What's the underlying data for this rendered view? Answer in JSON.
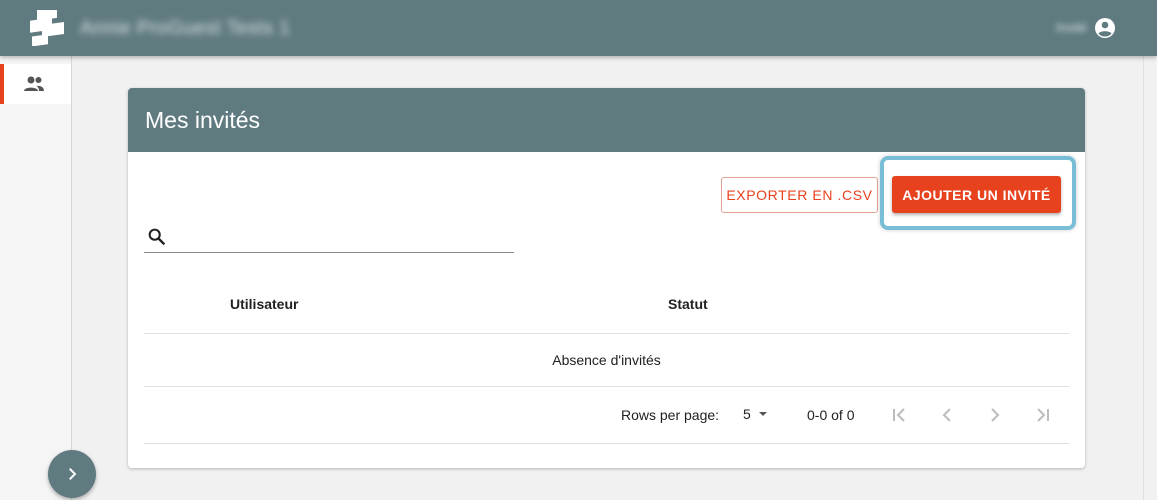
{
  "appbar": {
    "title": "Annie ProGuest Tests 1",
    "user_name": "Invité",
    "logo_icon": "stacked-squares-logo",
    "user_icon": "account-circle-icon"
  },
  "sidebar": {
    "items": [
      {
        "label": "Invités",
        "icon": "people-icon",
        "active": true
      }
    ],
    "expand_icon": "chevron-right-icon"
  },
  "card": {
    "title": "Mes invités",
    "export_label": "EXPORTER EN .CSV",
    "add_label": "AJOUTER UN INVITÉ"
  },
  "search": {
    "placeholder": "",
    "value": "",
    "icon": "search-icon"
  },
  "table": {
    "columns": [
      "Utilisateur",
      "Statut"
    ],
    "empty_message": "Absence d'invités"
  },
  "pagination": {
    "rows_label": "Rows per page:",
    "rows_value": "5",
    "range": "0-0 of 0"
  },
  "colors": {
    "brand": "#607b80",
    "accent": "#e8411e",
    "highlight": "#78bed6"
  }
}
